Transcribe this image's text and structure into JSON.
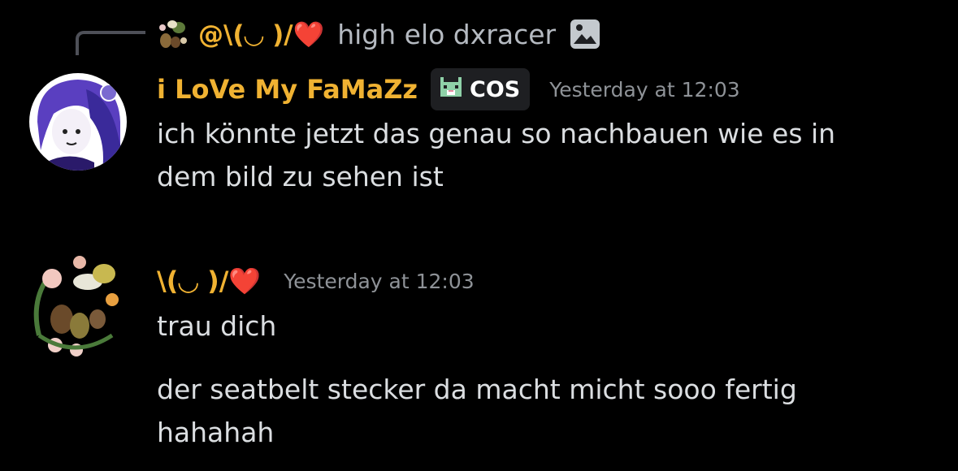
{
  "reply": {
    "author": "@\\(◡ )/❤️",
    "text": "high elo dxracer",
    "attachment_icon": "image-icon"
  },
  "messages": [
    {
      "author": "i LoVe My FaMaZz",
      "author_color": "#f0b232",
      "tag": {
        "icon": "pixel-cat-icon",
        "label": "COS"
      },
      "timestamp": "Yesterday at 12:03",
      "lines": [
        "ich könnte jetzt das genau so nachbauen wie es in",
        "dem bild zu sehen ist"
      ]
    },
    {
      "author": "\\(◡ )/❤️",
      "author_color": "#f0b232",
      "timestamp": "Yesterday at 12:03",
      "lines": [
        "trau dich"
      ],
      "lines2": [
        "der seatbelt stecker da macht micht sooo fertig",
        "hahahah"
      ]
    }
  ],
  "colors": {
    "background": "#000000",
    "text": "#dbdee1",
    "muted": "#8e9297",
    "username": "#f0b232"
  }
}
